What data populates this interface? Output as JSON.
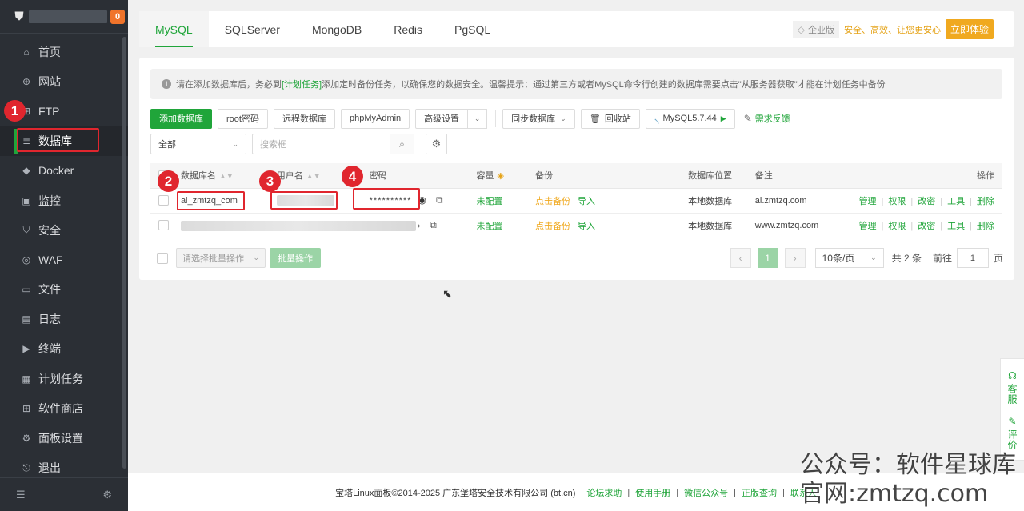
{
  "sidebar": {
    "badge": "0",
    "items": [
      {
        "label": "首页",
        "icon": "home-icon",
        "glyph": "⌂"
      },
      {
        "label": "网站",
        "icon": "globe-icon",
        "glyph": "⊕"
      },
      {
        "label": "FTP",
        "icon": "ftp-icon",
        "glyph": "⊞"
      },
      {
        "label": "数据库",
        "icon": "database-icon",
        "glyph": "≣"
      },
      {
        "label": "Docker",
        "icon": "docker-icon",
        "glyph": "◆"
      },
      {
        "label": "监控",
        "icon": "monitor-icon",
        "glyph": "▣"
      },
      {
        "label": "安全",
        "icon": "shield-icon",
        "glyph": "⛉"
      },
      {
        "label": "WAF",
        "icon": "waf-icon",
        "glyph": "◎"
      },
      {
        "label": "文件",
        "icon": "folder-icon",
        "glyph": "▭"
      },
      {
        "label": "日志",
        "icon": "log-icon",
        "glyph": "▤"
      },
      {
        "label": "终端",
        "icon": "terminal-icon",
        "glyph": "▶"
      },
      {
        "label": "计划任务",
        "icon": "cron-icon",
        "glyph": "▦"
      },
      {
        "label": "软件商店",
        "icon": "store-icon",
        "glyph": "⊞"
      },
      {
        "label": "面板设置",
        "icon": "settings-icon",
        "glyph": "⚙"
      },
      {
        "label": "退出",
        "icon": "logout-icon",
        "glyph": "⎋"
      }
    ]
  },
  "tabs": [
    "MySQL",
    "SQLServer",
    "MongoDB",
    "Redis",
    "PgSQL"
  ],
  "enterprise": {
    "tag": "企业版",
    "text": "安全、高效、让您更安心",
    "button": "立即体验"
  },
  "notice": {
    "pre": "请在添加数据库后，务必到",
    "link": "[计划任务]",
    "post": "添加定时备份任务，以确保您的数据安全。温馨提示：通过第三方或者MySQL命令行创建的数据库需要点击\"从服务器获取\"才能在计划任务中备份"
  },
  "toolbar": {
    "add": "添加数据库",
    "root": "root密码",
    "remote": "远程数据库",
    "pma": "phpMyAdmin",
    "advanced": "高级设置",
    "sync": "同步数据库",
    "recycle": "回收站",
    "version": "MySQL5.7.44",
    "feedback": "需求反馈"
  },
  "filter": {
    "select": "全部",
    "search_placeholder": "搜索框"
  },
  "table": {
    "headers": {
      "name": "数据库名",
      "user": "用户名",
      "password": "密码",
      "size": "容量",
      "backup": "备份",
      "location": "数据库位置",
      "remark": "备注",
      "ops": "操作"
    },
    "rows": [
      {
        "name": "ai_zmtzq_com",
        "password": "**********",
        "size": "未配置",
        "backup_link": "点击备份",
        "import": "导入",
        "location": "本地数据库",
        "remark": "ai.zmtzq.com"
      },
      {
        "name": "",
        "password": "",
        "size": "未配置",
        "backup_link": "点击备份",
        "import": "导入",
        "location": "本地数据库",
        "remark": "www.zmtzq.com"
      }
    ],
    "ops": [
      "管理",
      "权限",
      "改密",
      "工具",
      "删除"
    ]
  },
  "bulk": {
    "select": "请选择批量操作",
    "button": "批量操作"
  },
  "pager": {
    "current": "1",
    "per_page": "10条/页",
    "total": "共 2 条",
    "goto": "前往",
    "page_input": "1",
    "page_unit": "页"
  },
  "annotations": [
    "1",
    "2",
    "3",
    "4"
  ],
  "footer": {
    "copyright": "宝塔Linux面板©2014-2025 广东堡塔安全技术有限公司 (bt.cn)",
    "links": [
      "论坛求助",
      "使用手册",
      "微信公众号",
      "正版查询",
      "联系人"
    ]
  },
  "float": {
    "service": "客服",
    "review": "评价"
  },
  "watermark": {
    "line1": "公众号：软件星球库",
    "line2": "官网:zmtzq.com"
  },
  "colors": {
    "brand": "#20a53a",
    "warning": "#f0a91f",
    "highlight": "#e0262e",
    "sidebar": "#2b2f35"
  }
}
